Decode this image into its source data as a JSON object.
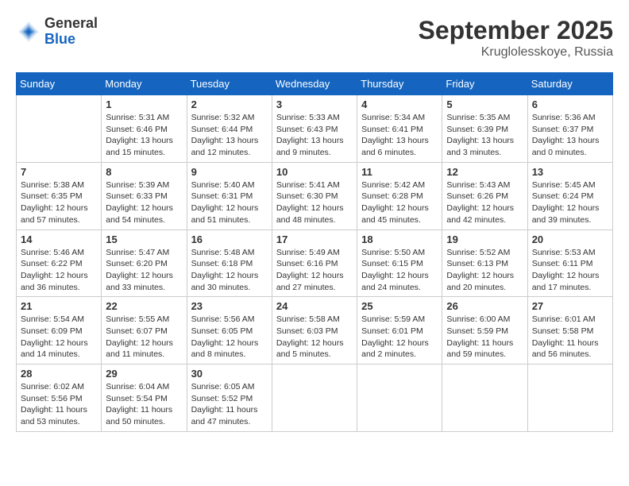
{
  "header": {
    "logo": {
      "general": "General",
      "blue": "Blue"
    },
    "title": "September 2025",
    "location": "Kruglolesskoye, Russia"
  },
  "weekdays": [
    "Sunday",
    "Monday",
    "Tuesday",
    "Wednesday",
    "Thursday",
    "Friday",
    "Saturday"
  ],
  "weeks": [
    [
      {
        "day": null
      },
      {
        "day": 1,
        "sunrise": "Sunrise: 5:31 AM",
        "sunset": "Sunset: 6:46 PM",
        "daylight": "Daylight: 13 hours and 15 minutes."
      },
      {
        "day": 2,
        "sunrise": "Sunrise: 5:32 AM",
        "sunset": "Sunset: 6:44 PM",
        "daylight": "Daylight: 13 hours and 12 minutes."
      },
      {
        "day": 3,
        "sunrise": "Sunrise: 5:33 AM",
        "sunset": "Sunset: 6:43 PM",
        "daylight": "Daylight: 13 hours and 9 minutes."
      },
      {
        "day": 4,
        "sunrise": "Sunrise: 5:34 AM",
        "sunset": "Sunset: 6:41 PM",
        "daylight": "Daylight: 13 hours and 6 minutes."
      },
      {
        "day": 5,
        "sunrise": "Sunrise: 5:35 AM",
        "sunset": "Sunset: 6:39 PM",
        "daylight": "Daylight: 13 hours and 3 minutes."
      },
      {
        "day": 6,
        "sunrise": "Sunrise: 5:36 AM",
        "sunset": "Sunset: 6:37 PM",
        "daylight": "Daylight: 13 hours and 0 minutes."
      }
    ],
    [
      {
        "day": 7,
        "sunrise": "Sunrise: 5:38 AM",
        "sunset": "Sunset: 6:35 PM",
        "daylight": "Daylight: 12 hours and 57 minutes."
      },
      {
        "day": 8,
        "sunrise": "Sunrise: 5:39 AM",
        "sunset": "Sunset: 6:33 PM",
        "daylight": "Daylight: 12 hours and 54 minutes."
      },
      {
        "day": 9,
        "sunrise": "Sunrise: 5:40 AM",
        "sunset": "Sunset: 6:31 PM",
        "daylight": "Daylight: 12 hours and 51 minutes."
      },
      {
        "day": 10,
        "sunrise": "Sunrise: 5:41 AM",
        "sunset": "Sunset: 6:30 PM",
        "daylight": "Daylight: 12 hours and 48 minutes."
      },
      {
        "day": 11,
        "sunrise": "Sunrise: 5:42 AM",
        "sunset": "Sunset: 6:28 PM",
        "daylight": "Daylight: 12 hours and 45 minutes."
      },
      {
        "day": 12,
        "sunrise": "Sunrise: 5:43 AM",
        "sunset": "Sunset: 6:26 PM",
        "daylight": "Daylight: 12 hours and 42 minutes."
      },
      {
        "day": 13,
        "sunrise": "Sunrise: 5:45 AM",
        "sunset": "Sunset: 6:24 PM",
        "daylight": "Daylight: 12 hours and 39 minutes."
      }
    ],
    [
      {
        "day": 14,
        "sunrise": "Sunrise: 5:46 AM",
        "sunset": "Sunset: 6:22 PM",
        "daylight": "Daylight: 12 hours and 36 minutes."
      },
      {
        "day": 15,
        "sunrise": "Sunrise: 5:47 AM",
        "sunset": "Sunset: 6:20 PM",
        "daylight": "Daylight: 12 hours and 33 minutes."
      },
      {
        "day": 16,
        "sunrise": "Sunrise: 5:48 AM",
        "sunset": "Sunset: 6:18 PM",
        "daylight": "Daylight: 12 hours and 30 minutes."
      },
      {
        "day": 17,
        "sunrise": "Sunrise: 5:49 AM",
        "sunset": "Sunset: 6:16 PM",
        "daylight": "Daylight: 12 hours and 27 minutes."
      },
      {
        "day": 18,
        "sunrise": "Sunrise: 5:50 AM",
        "sunset": "Sunset: 6:15 PM",
        "daylight": "Daylight: 12 hours and 24 minutes."
      },
      {
        "day": 19,
        "sunrise": "Sunrise: 5:52 AM",
        "sunset": "Sunset: 6:13 PM",
        "daylight": "Daylight: 12 hours and 20 minutes."
      },
      {
        "day": 20,
        "sunrise": "Sunrise: 5:53 AM",
        "sunset": "Sunset: 6:11 PM",
        "daylight": "Daylight: 12 hours and 17 minutes."
      }
    ],
    [
      {
        "day": 21,
        "sunrise": "Sunrise: 5:54 AM",
        "sunset": "Sunset: 6:09 PM",
        "daylight": "Daylight: 12 hours and 14 minutes."
      },
      {
        "day": 22,
        "sunrise": "Sunrise: 5:55 AM",
        "sunset": "Sunset: 6:07 PM",
        "daylight": "Daylight: 12 hours and 11 minutes."
      },
      {
        "day": 23,
        "sunrise": "Sunrise: 5:56 AM",
        "sunset": "Sunset: 6:05 PM",
        "daylight": "Daylight: 12 hours and 8 minutes."
      },
      {
        "day": 24,
        "sunrise": "Sunrise: 5:58 AM",
        "sunset": "Sunset: 6:03 PM",
        "daylight": "Daylight: 12 hours and 5 minutes."
      },
      {
        "day": 25,
        "sunrise": "Sunrise: 5:59 AM",
        "sunset": "Sunset: 6:01 PM",
        "daylight": "Daylight: 12 hours and 2 minutes."
      },
      {
        "day": 26,
        "sunrise": "Sunrise: 6:00 AM",
        "sunset": "Sunset: 5:59 PM",
        "daylight": "Daylight: 11 hours and 59 minutes."
      },
      {
        "day": 27,
        "sunrise": "Sunrise: 6:01 AM",
        "sunset": "Sunset: 5:58 PM",
        "daylight": "Daylight: 11 hours and 56 minutes."
      }
    ],
    [
      {
        "day": 28,
        "sunrise": "Sunrise: 6:02 AM",
        "sunset": "Sunset: 5:56 PM",
        "daylight": "Daylight: 11 hours and 53 minutes."
      },
      {
        "day": 29,
        "sunrise": "Sunrise: 6:04 AM",
        "sunset": "Sunset: 5:54 PM",
        "daylight": "Daylight: 11 hours and 50 minutes."
      },
      {
        "day": 30,
        "sunrise": "Sunrise: 6:05 AM",
        "sunset": "Sunset: 5:52 PM",
        "daylight": "Daylight: 11 hours and 47 minutes."
      },
      {
        "day": null
      },
      {
        "day": null
      },
      {
        "day": null
      },
      {
        "day": null
      }
    ]
  ]
}
